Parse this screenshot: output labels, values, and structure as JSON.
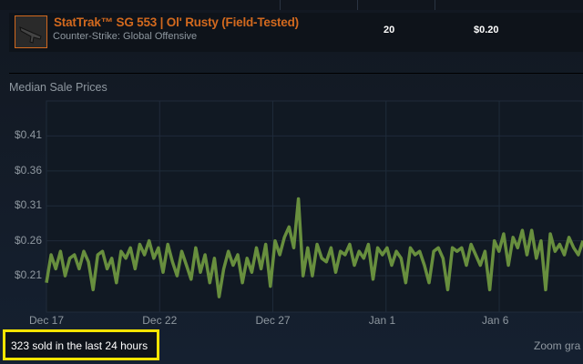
{
  "listing": {
    "name": "StatTrak™ SG 553 | Ol' Rusty (Field-Tested)",
    "game": "Counter-Strike: Global Offensive",
    "quantity": "20",
    "price": "$0.20"
  },
  "chart_title": "Median Sale Prices",
  "sold_text": "323 sold in the last 24 hours",
  "zoom_text": "Zoom gra",
  "colors": {
    "line": "#688f3e",
    "accent": "#d2691e",
    "highlight": "#f5e400"
  },
  "chart_data": {
    "type": "line",
    "title": "Median Sale Prices",
    "ylabel": "",
    "xlabel": "",
    "y_ticks": [
      {
        "v": 0.41,
        "label": "$0.41"
      },
      {
        "v": 0.36,
        "label": "$0.36"
      },
      {
        "v": 0.31,
        "label": "$0.31"
      },
      {
        "v": 0.26,
        "label": "$0.26"
      },
      {
        "v": 0.21,
        "label": "$0.21"
      }
    ],
    "x_ticks": [
      {
        "d": 0,
        "label": "Dec 17"
      },
      {
        "d": 5,
        "label": "Dec 22"
      },
      {
        "d": 10,
        "label": "Dec 27"
      },
      {
        "d": 15,
        "label": "Jan 1"
      },
      {
        "d": 20,
        "label": "Jan 6"
      }
    ],
    "ylim": [
      0.158,
      0.46
    ],
    "xlim_days": [
      0,
      23.7
    ],
    "grid": true,
    "values": [
      0.2,
      0.24,
      0.22,
      0.245,
      0.21,
      0.235,
      0.24,
      0.22,
      0.245,
      0.23,
      0.19,
      0.24,
      0.245,
      0.22,
      0.235,
      0.2,
      0.245,
      0.235,
      0.25,
      0.22,
      0.255,
      0.24,
      0.26,
      0.235,
      0.25,
      0.215,
      0.255,
      0.23,
      0.21,
      0.245,
      0.225,
      0.205,
      0.25,
      0.215,
      0.24,
      0.2,
      0.235,
      0.18,
      0.22,
      0.245,
      0.225,
      0.24,
      0.2,
      0.235,
      0.215,
      0.25,
      0.22,
      0.255,
      0.195,
      0.26,
      0.24,
      0.265,
      0.28,
      0.25,
      0.32,
      0.21,
      0.25,
      0.21,
      0.255,
      0.235,
      0.23,
      0.25,
      0.215,
      0.245,
      0.24,
      0.255,
      0.225,
      0.245,
      0.235,
      0.255,
      0.205,
      0.25,
      0.24,
      0.25,
      0.225,
      0.245,
      0.235,
      0.2,
      0.25,
      0.24,
      0.245,
      0.225,
      0.2,
      0.245,
      0.25,
      0.235,
      0.19,
      0.25,
      0.245,
      0.25,
      0.225,
      0.255,
      0.24,
      0.225,
      0.245,
      0.19,
      0.26,
      0.245,
      0.27,
      0.225,
      0.265,
      0.25,
      0.275,
      0.24,
      0.275,
      0.235,
      0.26,
      0.19,
      0.27,
      0.245,
      0.255,
      0.24,
      0.265,
      0.25,
      0.24,
      0.26
    ]
  }
}
